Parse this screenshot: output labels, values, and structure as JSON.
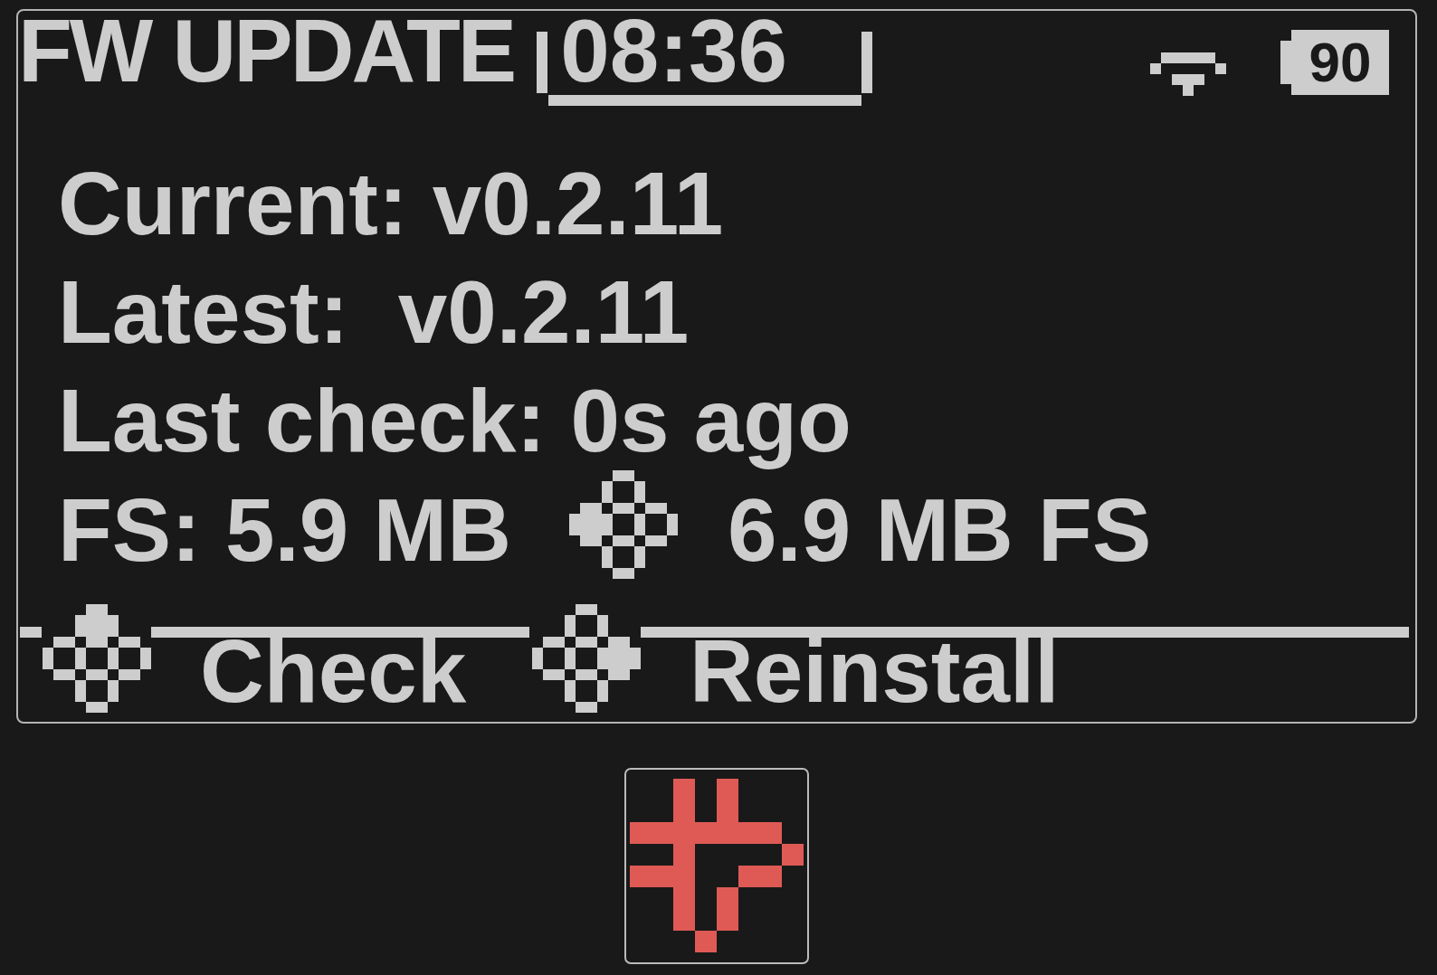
{
  "header": {
    "title": "FW UPDATE",
    "clock": "08:36",
    "battery": "90"
  },
  "info": {
    "lines": [
      "Current: v0.2.11",
      "Latest:  v0.2.11",
      "Last check: 0s ago"
    ],
    "fs_swap": {
      "from": "FS: 5.9 MB",
      "to": "6.9 MB FS"
    }
  },
  "actions": [
    {
      "label": "Check"
    },
    {
      "label": "Reinstall"
    }
  ]
}
